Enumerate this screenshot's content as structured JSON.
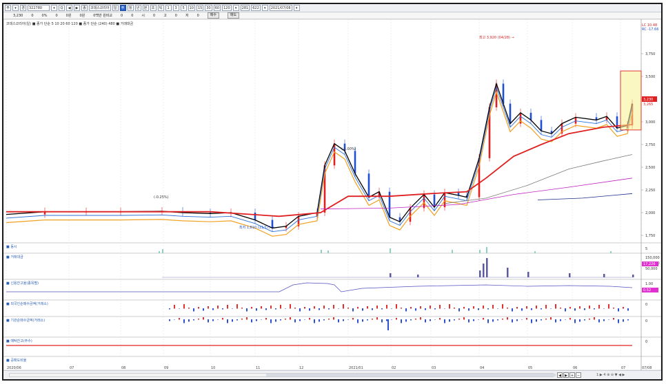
{
  "toolbar": {
    "items": [
      "주",
      "▾",
      "경",
      "322780",
      "▾",
      "Q",
      "◀",
      "▶",
      "종",
      "코데스코리아",
      "일",
      "주",
      "월",
      "년",
      "분",
      "초",
      "틱",
      "1",
      "3",
      "5",
      "10",
      "15",
      "30",
      "60",
      "120",
      "▾",
      "281",
      "622",
      "▾",
      "2021/07/08",
      "▾"
    ],
    "active_index": 11
  },
  "inforow": {
    "values": [
      "3,230",
      "0",
      "0%",
      "0",
      "0원",
      "0원",
      "0백만 원비교",
      "0",
      "0",
      "시",
      "0",
      "고",
      "0",
      "저",
      "0"
    ],
    "buttons": [
      "매수",
      "매도"
    ]
  },
  "price_panel": {
    "title": "코데스코리아(일) ■ 종가 단순 5 10 20 60 120 ■ 종가 단순 (240) 480 ■ 거래대금",
    "labels": {
      "high_note": "최고 3,920 (04/28) →",
      "low_note": "최저 1,810 (11/17) →",
      "change_note": "(-0.25%)",
      "peak_pct": "(-1.00%)",
      "current": "3,230",
      "current2": "3,265",
      "rc1": "LC 10.48",
      "rc2": "RC -17.66"
    },
    "y_ticks": [
      "3,750",
      "3,500",
      "3,250",
      "3,000",
      "2,750",
      "2,500",
      "2,250",
      "2,000",
      "1,750"
    ],
    "colors": {
      "ma5": "#000000",
      "ma10": "#2b6fd6",
      "ma20": "#f0a020",
      "ma60": "#e02020",
      "ma120": "#7a7a7a",
      "ma240": "#c020c0",
      "ma480": "#1a2a8a",
      "up": "#e02020",
      "down": "#2050d0"
    }
  },
  "sub_panels": [
    {
      "title": "■ 동시",
      "tick": "5"
    },
    {
      "title": "■ 거래대금",
      "ticks": [
        "150,000",
        "100,000",
        "50,000"
      ],
      "badge": "17,226"
    },
    {
      "title": "■ 신용잔고율(종목별)",
      "ticks": [
        "1.00"
      ],
      "badge": "0.52"
    },
    {
      "title": "■ 외국인순매수금액(거래소)",
      "ticks": [
        "0"
      ]
    },
    {
      "title": "■ 기관순매수금액(거래소)",
      "ticks": [
        "0"
      ]
    },
    {
      "title": "■ 예탁잔고(주수)",
      "ticks": [
        "0"
      ]
    },
    {
      "title": "■ 공매도비율",
      "ticks": []
    }
  ],
  "x_axis": [
    "2020/06",
    "07",
    "08",
    "09",
    "10",
    "11",
    "12",
    "2021/01",
    "02",
    "03",
    "04",
    "05",
    "06",
    "07",
    "07/08"
  ],
  "statusbar": {
    "right_text": "1:▶ 4 ⊕ ⊖ ▼ ◀ ▶"
  }
}
